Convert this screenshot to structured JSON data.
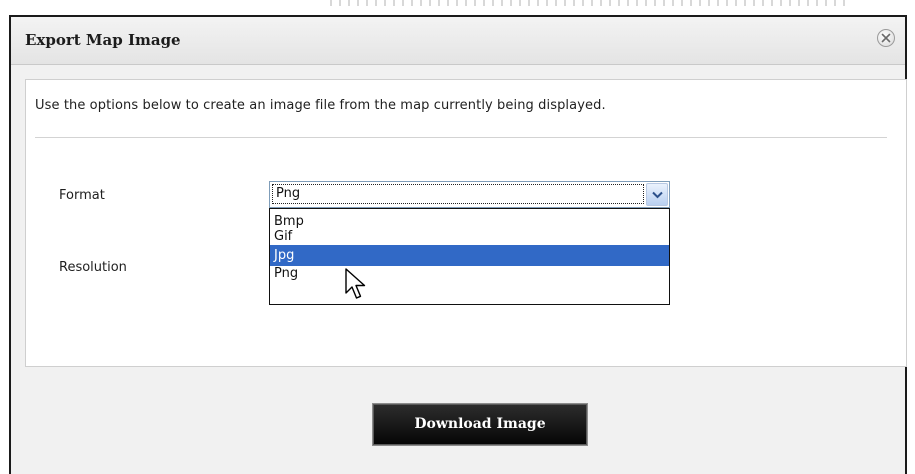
{
  "dialog": {
    "title": "Export Map Image",
    "close_icon": "close-circle-icon",
    "intro": "Use the options below to create an image file from the map currently being displayed."
  },
  "form": {
    "format_label": "Format",
    "resolution_label": "Resolution",
    "format_select": {
      "value": "Png",
      "arrow_icon": "chevron-down-icon",
      "options": [
        "Bmp",
        "Gif",
        "Jpg",
        "Png"
      ],
      "highlighted": "Jpg"
    }
  },
  "actions": {
    "download_label": "Download Image"
  },
  "colors": {
    "highlight": "#3169c6",
    "button_bg": "#111111",
    "panel_bg": "#f1f1f1"
  }
}
